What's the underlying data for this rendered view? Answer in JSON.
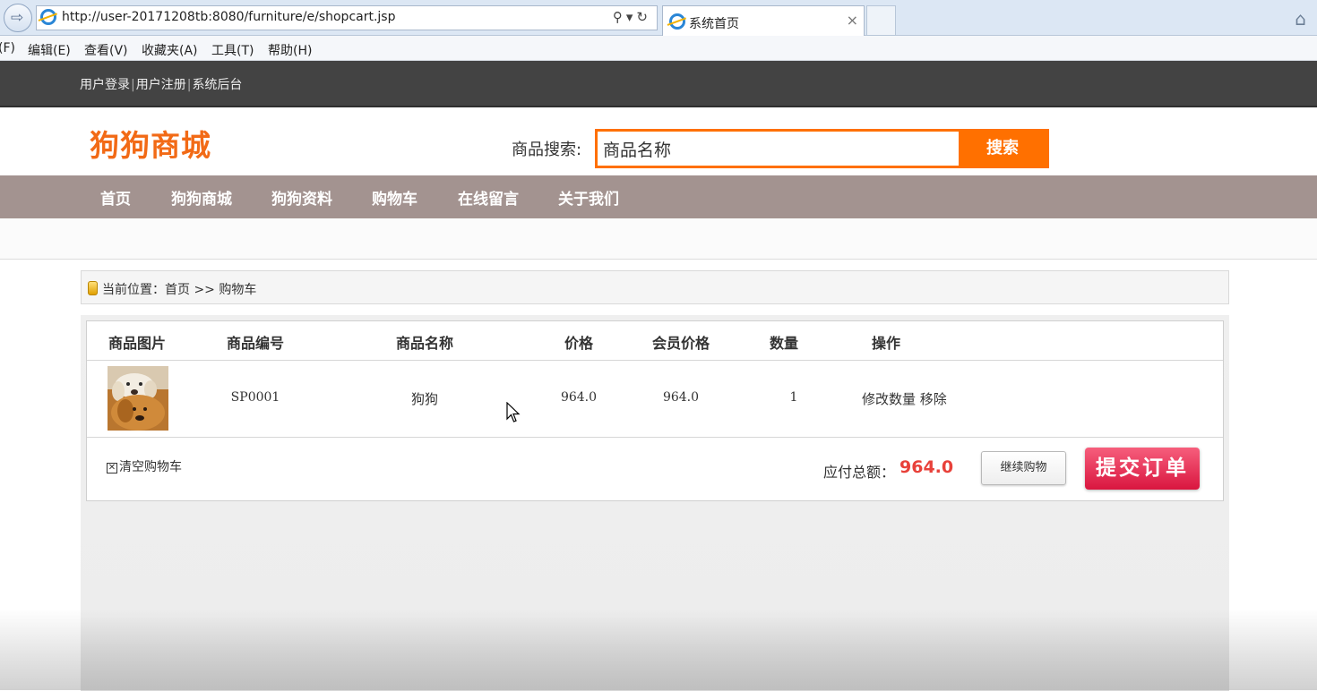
{
  "browser": {
    "url": "http://user-20171208tb:8080/furniture/e/shopcart.jsp",
    "tab_title": "系统首页",
    "tab_close": "×",
    "menu": [
      "(F)",
      "编辑(E)",
      "查看(V)",
      "收藏夹(A)",
      "工具(T)",
      "帮助(H)"
    ]
  },
  "topbar": {
    "login": "用户登录",
    "register": "用户注册",
    "admin": "系统后台",
    "separator": "|"
  },
  "header": {
    "logo": "狗狗商城",
    "search_label": "商品搜索:",
    "search_value": "商品名称",
    "search_button": "搜索"
  },
  "nav": [
    "首页",
    "狗狗商城",
    "狗狗资料",
    "购物车",
    "在线留言",
    "关于我们"
  ],
  "breadcrumb": "当前位置：首页 >> 购物车",
  "cart": {
    "columns": [
      "商品图片",
      "商品编号",
      "商品名称",
      "价格",
      "会员价格",
      "数量",
      "操作"
    ],
    "rows": [
      {
        "code": "SP0001",
        "name": "狗狗",
        "price": "964.0",
        "member_price": "964.0",
        "quantity": "1",
        "op_modify": "修改数量",
        "op_remove": "移除"
      }
    ],
    "clear_label": "清空购物车",
    "total_label": "应付总额：",
    "total_value": "964.0",
    "continue_button": "继续购物",
    "submit_button": "提交订单"
  },
  "colors": {
    "accent_orange": "#ff7000",
    "logo_orange": "#f26a16",
    "nav_bg": "#a39390",
    "topbar_bg": "#434343",
    "submit_red": "#e0244a",
    "total_red": "#e8413a"
  },
  "icons": [
    "back-arrow-icon",
    "ie-logo-icon",
    "search-icon",
    "refresh-icon",
    "home-icon",
    "breadcrumb-icon",
    "clear-box-icon",
    "mouse-cursor-icon"
  ]
}
